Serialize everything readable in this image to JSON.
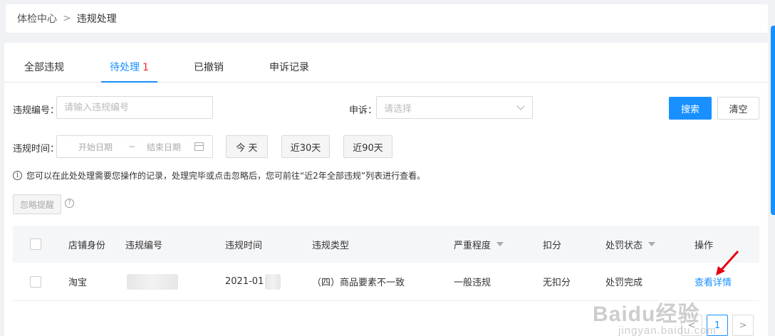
{
  "breadcrumb": {
    "root": "体检中心",
    "separator": ">",
    "current": "违规处理"
  },
  "tabs": [
    {
      "label": "全部违规"
    },
    {
      "label": "待处理",
      "count": "1"
    },
    {
      "label": "已撤销"
    },
    {
      "label": "申诉记录"
    }
  ],
  "filters": {
    "violation_id_label": "违规编号：",
    "violation_id_placeholder": "请输入违规编号",
    "appeal_label": "申诉：",
    "appeal_placeholder": "请选择",
    "time_label": "违规时间：",
    "start_date_placeholder": "开始日期",
    "range_sep": "~",
    "end_date_placeholder": "结束日期",
    "today_label": "今 天",
    "last30_label": "近30天",
    "last90_label": "近90天",
    "search_label": "搜索",
    "clear_label": "清空"
  },
  "info_text": "您可以在此处处理需要您操作的记录，处理完毕或点击忽略后，您可前往“近2年全部违规”列表进行查看。",
  "ignore_label": "忽略提醒",
  "table": {
    "headers": {
      "shop_identity": "店铺身份",
      "violation_id": "违规编号",
      "violation_time": "违规时间",
      "violation_type": "违规类型",
      "severity": "严重程度",
      "deduction": "扣分",
      "penalty_status": "处罚状态",
      "action": "操作"
    },
    "rows": [
      {
        "shop_identity": "淘宝",
        "violation_time": "2021-01",
        "violation_type": "（四）商品要素不一致",
        "severity": "一般违规",
        "deduction": "无扣分",
        "penalty_status": "处罚完成",
        "action": "查看详情"
      }
    ]
  },
  "pagination": {
    "prev": "<",
    "current": "1",
    "next": ">"
  },
  "watermark": {
    "logo": "Baidu经验",
    "url": "jingyan.baidu.com"
  },
  "colors": {
    "primary": "#1890ff",
    "danger": "#f5222d",
    "annotation_arrow": "#e60012"
  }
}
